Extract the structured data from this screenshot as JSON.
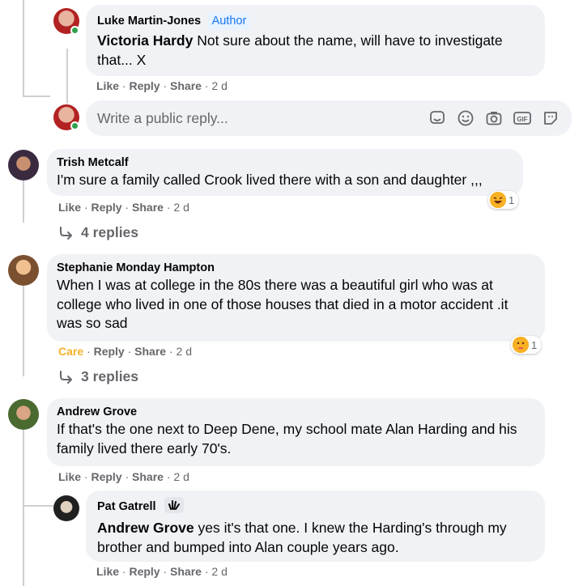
{
  "comments": [
    {
      "name": "Luke Martin-Jones",
      "badge": "Author",
      "mention": "Victoria Hardy",
      "text": " Not sure about the name, will have to investigate that... X",
      "actions": [
        "Like",
        "Reply",
        "Share"
      ],
      "time": "2 d"
    },
    {
      "name": "Trish Metcalf",
      "text": "I'm sure a family called Crook lived there with a son and daughter ,,,",
      "actions": [
        "Like",
        "Reply",
        "Share"
      ],
      "time": "2 d",
      "reaction_count": "1",
      "replies": "4 replies"
    },
    {
      "name": "Stephanie Monday Hampton",
      "text": "When I was at college in the 80s there was a beautiful girl who was at college who lived in one of those houses that died in a motor accident .it was so sad",
      "actions": [
        "Care",
        "Reply",
        "Share"
      ],
      "time": "2 d",
      "reaction_count": "1",
      "replies": "3 replies"
    },
    {
      "name": "Andrew Grove",
      "text": "If that's the one next to Deep Dene, my school mate Alan Harding and his family lived there early 70's.",
      "actions": [
        "Like",
        "Reply",
        "Share"
      ],
      "time": "2 d"
    },
    {
      "name": "Pat Gatrell",
      "mention": "Andrew Grove",
      "text": " yes it's that one. I knew the Harding's through my brother and bumped into Alan couple years ago.",
      "actions": [
        "Like",
        "Reply",
        "Share"
      ],
      "time": "2 d"
    }
  ],
  "reply_box": {
    "placeholder": "Write a public reply..."
  },
  "colors": {
    "bubble": "#f0f2f5",
    "meta": "#65676b",
    "author_badge": "#1876f2",
    "care": "#f7b125",
    "online": "#31a24c"
  }
}
